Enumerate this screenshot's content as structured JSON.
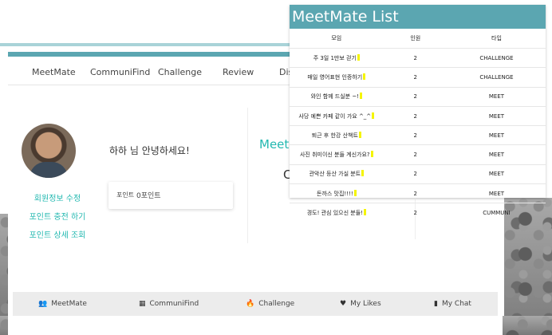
{
  "nav": {
    "items": [
      "MeetMate",
      "CommuniFind",
      "Challenge",
      "Review",
      "Dis"
    ]
  },
  "profile": {
    "greeting": "하하 님 안녕하세요!",
    "points_label": "포인트",
    "points_value": "0포인트",
    "links": [
      "회원정보 수정",
      "포인트 충전 하기",
      "포인트 상세 조회"
    ]
  },
  "partial_text": {
    "meet": "Meet",
    "zero": "C"
  },
  "bottom_nav": {
    "items": [
      {
        "label": "MeetMate",
        "icon": "people-icon"
      },
      {
        "label": "CommuniFind",
        "icon": "grid-icon"
      },
      {
        "label": "Challenge",
        "icon": "fire-icon"
      },
      {
        "label": "My Likes",
        "icon": "heart-icon"
      },
      {
        "label": "My Chat",
        "icon": "bookmark-icon"
      }
    ]
  },
  "modal": {
    "title": "MeetMate List",
    "headers": [
      "모임",
      "인원",
      "타입"
    ],
    "rows": [
      {
        "name": "주 3일 1만보 걷기",
        "count": "2",
        "type": "CHALLENGE"
      },
      {
        "name": "매일 영어표현 인증하기",
        "count": "2",
        "type": "CHALLENGE"
      },
      {
        "name": "와인 함께 드실분 ~!",
        "count": "2",
        "type": "MEET"
      },
      {
        "name": "사당 예쁜 카페 같이 가요 ^_^",
        "count": "2",
        "type": "MEET"
      },
      {
        "name": "퇴근 후 한강 산책트",
        "count": "2",
        "type": "MEET"
      },
      {
        "name": "사진 취미이신 분들 계신가요?",
        "count": "2",
        "type": "MEET"
      },
      {
        "name": "관악산 등산 가실 분트",
        "count": "2",
        "type": "MEET"
      },
      {
        "name": "돈까스 맛집!!!!",
        "count": "2",
        "type": "MEET"
      },
      {
        "name": "경도! 관심 있으신 분들!",
        "count": "2",
        "type": "CUMMUNI"
      }
    ]
  },
  "colors": {
    "accent": "#5ba6b1",
    "link": "#22b8b0"
  }
}
